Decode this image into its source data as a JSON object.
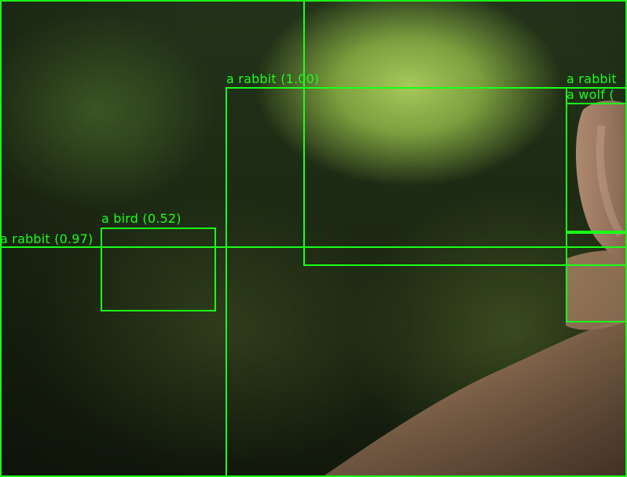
{
  "image": {
    "subject": "rabbit",
    "box_color": "#1aff1a"
  },
  "detections": [
    {
      "id": "det-frame",
      "label": "",
      "score": ""
    },
    {
      "id": "det-rabbit-100",
      "label": "a rabbit (1.00)"
    },
    {
      "id": "det-bird-052",
      "label": "a bird (0.52)"
    },
    {
      "id": "det-rabbit-097",
      "label": "a rabbit (0.97)"
    },
    {
      "id": "det-rabbit-right",
      "label": "a rabbit"
    },
    {
      "id": "det-wolf-right",
      "label": "a wolf ("
    }
  ]
}
